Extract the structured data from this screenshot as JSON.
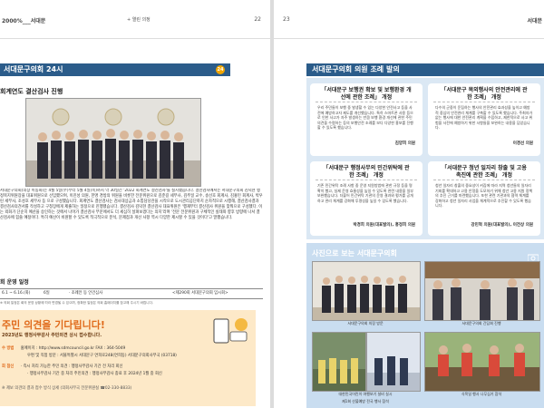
{
  "left": {
    "header_left": "2000%___서대문",
    "header_center": "+ 열린 의정",
    "page_number": "22",
    "section_title": "서대문구의회 24시",
    "section_badge": "24",
    "subtitle": "회계연도 결산검사 진행",
    "body": "서대문구의회(의장 이동화)는 4월 5일(수)부터 5월 4일(목)까지 약 30일간 '2022 회계연도 결산검사'를 실시했습니다. 결산검사에서는 서대문구의회 김덕현 행정복지위원장을 대표위원으로 선임했으며, 이진성 의원, 한명 경방의 위원을 비롯한 전문위원으로 김준길 세무사, 김주일 교수, 송선호 회계사, 김홍민 회계사, 박우린 세무사, 조성호 세무사 등 으로 구성했습니다. 회계연도 결산검사는 검사대상금과 소통담당관을 시작으로 도시관리공단까지 순차적으로 시행해, 결산검사결과 결산검사의견서를 작성하고 구청장에게 제출하는 일정으로 진행됐습니다. 결산검사 김덕현 결산검사 대표위원은 '행재부터 결산검사 위원을 맞춰으로 구성했다. 이는 외화가 단순히 예산을 승인하는 것에서 나아가 결산검사 부문에서도 더 세심히 살펴보겠다는 의지'라며 '전문 전문위원과 구체적인 실태와 향후 방향에 나서 결산검사에 힘쓸 예정이다. 특히 예산이 비원할 수 있도록 적극적으로 분석, 문제점과 개선 사항 역시 다양한 제시할 수 있을 것이다'고 말했습니다.",
    "schedule_title": "회 운영 일정",
    "schedule_period": "6.1 ~ 6.16.(화)",
    "schedule_days": "6일",
    "schedule_detail": "· 조례안 등 안건심사",
    "schedule_session": "<제290회 서대문구의회 임시회>",
    "schedule_note": "※ 의회 일정은 회의 운영 상황에 따라 변경될 수 있으며, 정확한 일정은 의회 홈페이지를 참고해 주시기 바랍니다.",
    "callout_title": "주민 의견을 기다립니다!",
    "callout_sub": "2023년도 행정사무감사 주민의견 상시 접수합니다.",
    "callout_row1_label": "수 방법",
    "callout_row1_text": "홈페이지 : http://www.sdmcouncil.go.kr   FAX : 364-5049",
    "callout_row2_text": "우편 및 직접 방문 : 서울특별시 서대문구 연희로248(연희동) 서대문구의회사무국 (03718)",
    "callout_row3_label": "회 참신",
    "callout_row3_text": "· 즉시 처리 가능한 주민 의견 : 행정사무감사 기간 전 처리 회신",
    "callout_row4_text": "· 행정사무감사 기간 중 처리 주민의견 : 행정사무감사 종료 후 2024년 1월 중 회신",
    "callout_footer": "※ 제보 의견의 결과 접수 방식 상세 (의회사무국 전문위원실 ☎02-330-8833)"
  },
  "right": {
    "page_number": "23",
    "header_right": "서대문",
    "section_title": "서대문구의회 의원 조례 발의",
    "cards": [
      {
        "title": "「서대문구 보행권 확보 및 보행환경 개선에 관한 조례」 개정",
        "body": "우리 주민들이 보행 중 발생할 수 있는 다양한 안전사고 등을 사전에 예방하고자 제도를 개선했습니다. 특히 스마트폰 사용 등으로 인한 사고가 자주 발생하는 만큼 보행 환경 개선에 관한 주민 의견을 수렴하는 등의 보행안전 조례를 보다 다양한 홍보를 진행할 수 있도록 했습니다.",
        "author": "김양희 의원"
      },
      {
        "title": "「서대문구 목외행사의 안전관리에 관한 조례」 개정",
        "body": "다수의 군중이 운집하는 행사의 안전관리 효과성을 높이고 예방적 중심의 안전관리 체계를 구축할 수 있도록 했습니다. 주최자가 없는 행사에 대한 안전관리 계획을 수립하고, 제한적으로 사고 위험을 사전에 예방하기 위한 사항들을 보완하는 내용을 담았습니다.",
        "author": "이경선 의원"
      },
      {
        "title": "「서대문구 행정사무의 민간위탁에 관한 조례」 개정",
        "body": "기존 민간위탁 조례 사항 중 운영 지원방법에 관한 규정 등을 명확히 했고, 실제 운영 효율성을 높일 수 있도록 관련 내용을 일부 보완했습니다. 더불어 민간위탁 기관의 운영 결과와 평가를 공개하고 관리 체계를 강화해 투명성을 높일 수 있도록 했습니다.",
        "author": "박경희 의원(대표발의), 홍정희 의원"
      },
      {
        "title": "「서대문구 청년 일자리 창출 및 고용 촉진에 관한 조례」 개정",
        "body": "청년 일자리 창출의 중요성이 커짐에 따라 지역 청년들의 일자리 기회를 확대하고 고용 안정을 도모하기 위해 청년 고용 지원 정책의 추진 근거를 마련했습니다. 또한 관련 기관과의 협력 체계를 강화하고 청년 일자리 사업을 체계적으로 추진할 수 있도록 했습니다.",
        "author": "강민혁 의원(대표발의), 이전상 의원"
      }
    ],
    "photo_section_title": "사진으로 보는 서대문구의회",
    "photo_captions": [
      "서대문구의회 의장 방문",
      "서대문구의회 간담회 진행",
      "제1회 산불예방 전국 행사 참석",
      "대한민국어린이 여행보기 설비 실시",
      "식목일 행사 나무심기 참석"
    ]
  }
}
